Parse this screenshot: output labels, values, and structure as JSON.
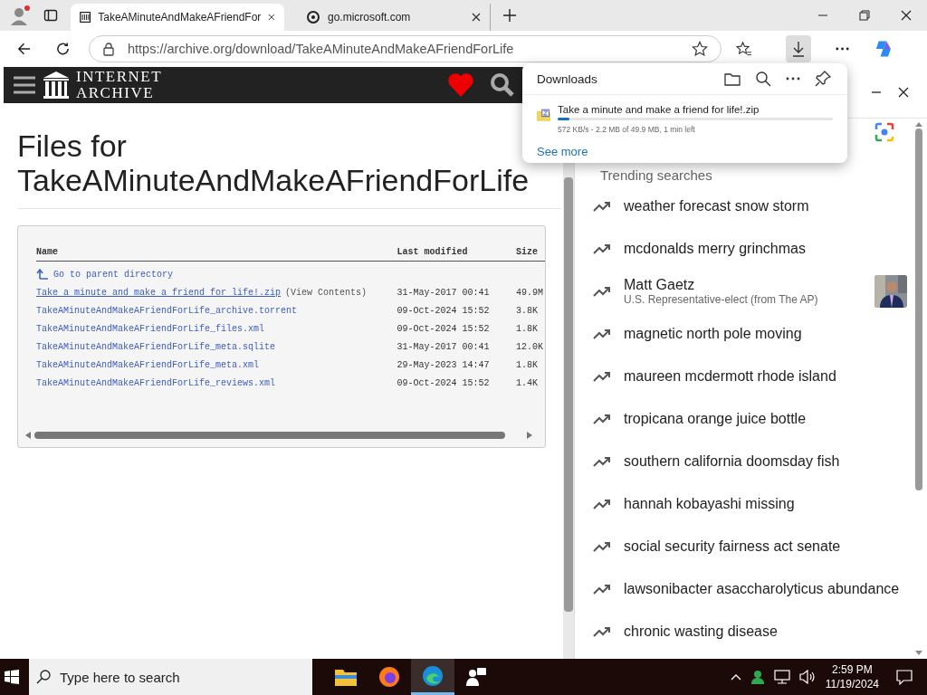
{
  "browser": {
    "tabs": [
      {
        "title": "TakeAMinuteAndMakeAFriendFor",
        "selected": true,
        "kind": "archive"
      },
      {
        "title": "go.microsoft.com",
        "selected": false,
        "kind": "edge"
      }
    ],
    "address": "https://archive.org/download/TakeAMinuteAndMakeAFriendForLife"
  },
  "page": {
    "logo_line_1": "INTERNET",
    "logo_line_2": "ARCHIVE",
    "title_line_1": "Files for",
    "title_line_2": "TakeAMinuteAndMakeAFriendForLife",
    "columns": [
      "Name",
      "Last modified",
      "Size"
    ],
    "parent_link": "Go to parent directory",
    "files": [
      {
        "name": "Take a minute and make a friend for life!.zip",
        "extra": "(View Contents)",
        "modified": "31-May-2017 00:41",
        "size": "49.9M"
      },
      {
        "name": "TakeAMinuteAndMakeAFriendForLife_archive.torrent",
        "modified": "09-Oct-2024 15:52",
        "size": "3.8K"
      },
      {
        "name": "TakeAMinuteAndMakeAFriendForLife_files.xml",
        "modified": "09-Oct-2024 15:52",
        "size": "1.8K"
      },
      {
        "name": "TakeAMinuteAndMakeAFriendForLife_meta.sqlite",
        "modified": "31-May-2017 00:41",
        "size": "12.0K"
      },
      {
        "name": "TakeAMinuteAndMakeAFriendForLife_meta.xml",
        "modified": "29-May-2023 14:47",
        "size": "1.8K"
      },
      {
        "name": "TakeAMinuteAndMakeAFriendForLife_reviews.xml",
        "modified": "09-Oct-2024 15:52",
        "size": "1.4K"
      }
    ]
  },
  "downloads": {
    "title": "Downloads",
    "file": "Take a minute and make a friend for life!.zip",
    "level": 0.044,
    "status": "572 KB/s - 2.2 MB of 49.9 MB, 1 min left",
    "see_more": "See more"
  },
  "side_panel": {
    "heading": "Trending searches",
    "items": [
      {
        "kind": "query",
        "title": "weather forecast snow storm"
      },
      {
        "kind": "query",
        "title": "mcdonalds merry grinchmas"
      },
      {
        "kind": "entity",
        "title": "Matt Gaetz",
        "subtitle": "U.S. Representative-elect (from The AP)"
      },
      {
        "kind": "query",
        "title": "magnetic north pole moving"
      },
      {
        "kind": "query",
        "title": "maureen mcdermott rhode island"
      },
      {
        "kind": "query",
        "title": "tropicana orange juice bottle"
      },
      {
        "kind": "query",
        "title": "southern california doomsday fish"
      },
      {
        "kind": "query",
        "title": "hannah kobayashi missing"
      },
      {
        "kind": "query",
        "title": "social security fairness act senate"
      },
      {
        "kind": "query",
        "title": "lawsonibacter asaccharolyticus abundance"
      },
      {
        "kind": "query",
        "title": "chronic wasting disease"
      }
    ]
  },
  "taskbar": {
    "search_placeholder": "Type here to search",
    "apps": [
      {
        "kind": "folder",
        "selected": false
      },
      {
        "kind": "firefox",
        "selected": false
      },
      {
        "kind": "edge",
        "selected": true
      },
      {
        "kind": "chat",
        "selected": false
      }
    ],
    "time": "2:59 PM",
    "date": "11/19/2024"
  }
}
